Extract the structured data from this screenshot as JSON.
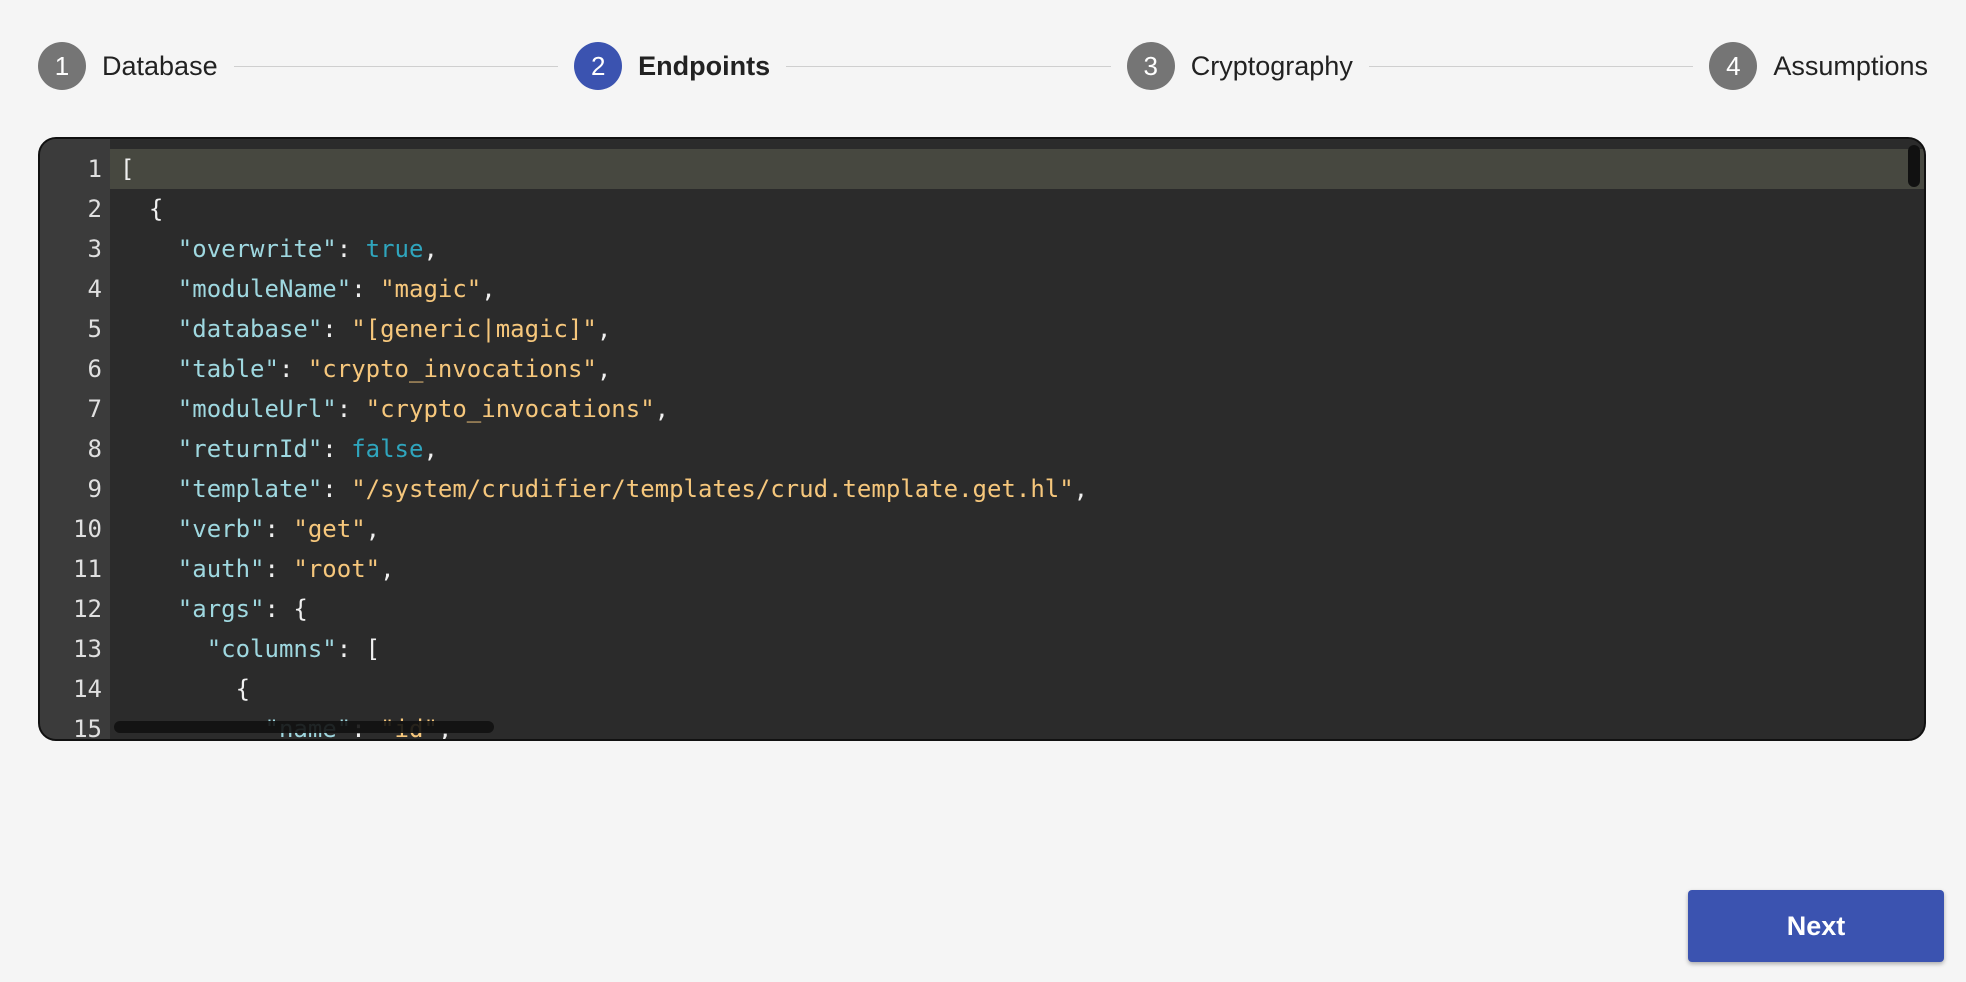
{
  "stepper": {
    "steps": [
      {
        "number": "1",
        "label": "Database",
        "active": false
      },
      {
        "number": "2",
        "label": "Endpoints",
        "active": true
      },
      {
        "number": "3",
        "label": "Cryptography",
        "active": false
      },
      {
        "number": "4",
        "label": "Assumptions",
        "active": false
      }
    ]
  },
  "editor": {
    "lines": [
      [
        [
          "punc",
          "["
        ]
      ],
      [
        [
          "punc",
          "  {"
        ]
      ],
      [
        [
          "punc",
          "    "
        ],
        [
          "key",
          "\"overwrite\""
        ],
        [
          "punc",
          ": "
        ],
        [
          "bool",
          "true"
        ],
        [
          "punc",
          ","
        ]
      ],
      [
        [
          "punc",
          "    "
        ],
        [
          "key",
          "\"moduleName\""
        ],
        [
          "punc",
          ": "
        ],
        [
          "str",
          "\"magic\""
        ],
        [
          "punc",
          ","
        ]
      ],
      [
        [
          "punc",
          "    "
        ],
        [
          "key",
          "\"database\""
        ],
        [
          "punc",
          ": "
        ],
        [
          "str",
          "\"[generic|magic]\""
        ],
        [
          "punc",
          ","
        ]
      ],
      [
        [
          "punc",
          "    "
        ],
        [
          "key",
          "\"table\""
        ],
        [
          "punc",
          ": "
        ],
        [
          "str",
          "\"crypto_invocations\""
        ],
        [
          "punc",
          ","
        ]
      ],
      [
        [
          "punc",
          "    "
        ],
        [
          "key",
          "\"moduleUrl\""
        ],
        [
          "punc",
          ": "
        ],
        [
          "str",
          "\"crypto_invocations\""
        ],
        [
          "punc",
          ","
        ]
      ],
      [
        [
          "punc",
          "    "
        ],
        [
          "key",
          "\"returnId\""
        ],
        [
          "punc",
          ": "
        ],
        [
          "bool",
          "false"
        ],
        [
          "punc",
          ","
        ]
      ],
      [
        [
          "punc",
          "    "
        ],
        [
          "key",
          "\"template\""
        ],
        [
          "punc",
          ": "
        ],
        [
          "str",
          "\"/system/crudifier/templates/crud.template.get.hl\""
        ],
        [
          "punc",
          ","
        ]
      ],
      [
        [
          "punc",
          "    "
        ],
        [
          "key",
          "\"verb\""
        ],
        [
          "punc",
          ": "
        ],
        [
          "str",
          "\"get\""
        ],
        [
          "punc",
          ","
        ]
      ],
      [
        [
          "punc",
          "    "
        ],
        [
          "key",
          "\"auth\""
        ],
        [
          "punc",
          ": "
        ],
        [
          "str",
          "\"root\""
        ],
        [
          "punc",
          ","
        ]
      ],
      [
        [
          "punc",
          "    "
        ],
        [
          "key",
          "\"args\""
        ],
        [
          "punc",
          ": {"
        ]
      ],
      [
        [
          "punc",
          "      "
        ],
        [
          "key",
          "\"columns\""
        ],
        [
          "punc",
          ": ["
        ]
      ],
      [
        [
          "punc",
          "        {"
        ]
      ],
      [
        [
          "punc",
          "          "
        ],
        [
          "key",
          "\"name\""
        ],
        [
          "punc",
          ": "
        ],
        [
          "str",
          "\"id\""
        ],
        [
          "punc",
          ","
        ]
      ]
    ],
    "active_line": 1
  },
  "actions": {
    "next_label": "Next"
  },
  "colors": {
    "accent": "#3b53b0",
    "inactive_step": "#757575",
    "editor_bg": "#2b2b2b",
    "key": "#9fd8e0",
    "string": "#f6c77c",
    "boolean": "#2fa5bd"
  }
}
